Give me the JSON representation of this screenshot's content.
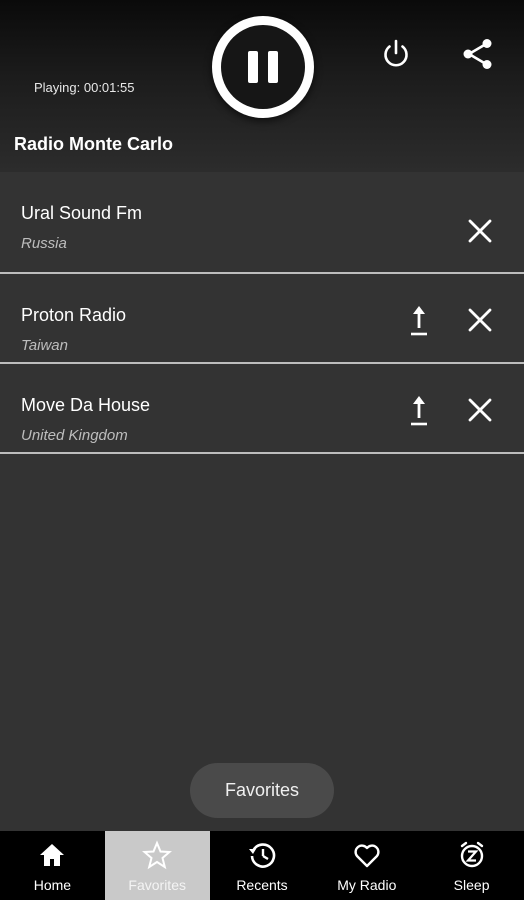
{
  "player": {
    "playing_text": "Playing: 00:01:55",
    "station_name": "Radio Monte Carlo",
    "state": "playing"
  },
  "favorites": [
    {
      "name": "Ural Sound Fm",
      "country": "Russia",
      "can_move_up": false
    },
    {
      "name": "Proton Radio",
      "country": "Taiwan",
      "can_move_up": true
    },
    {
      "name": "Move Da House",
      "country": "United Kingdom",
      "can_move_up": true
    }
  ],
  "toast": {
    "text": "Favorites"
  },
  "nav": {
    "items": [
      {
        "label": "Home",
        "icon": "home-icon"
      },
      {
        "label": "Favorites",
        "icon": "star-icon",
        "active": true
      },
      {
        "label": "Recents",
        "icon": "history-icon"
      },
      {
        "label": "My Radio",
        "icon": "heart-icon"
      },
      {
        "label": "Sleep",
        "icon": "sleep-timer-icon"
      }
    ]
  },
  "colors": {
    "background": "#333333",
    "header_top": "#0a0a0a",
    "divider": "#bdbdbd",
    "nav_background": "#000000",
    "nav_active": "#c9c9c9",
    "toast": "#4a4a4a"
  }
}
